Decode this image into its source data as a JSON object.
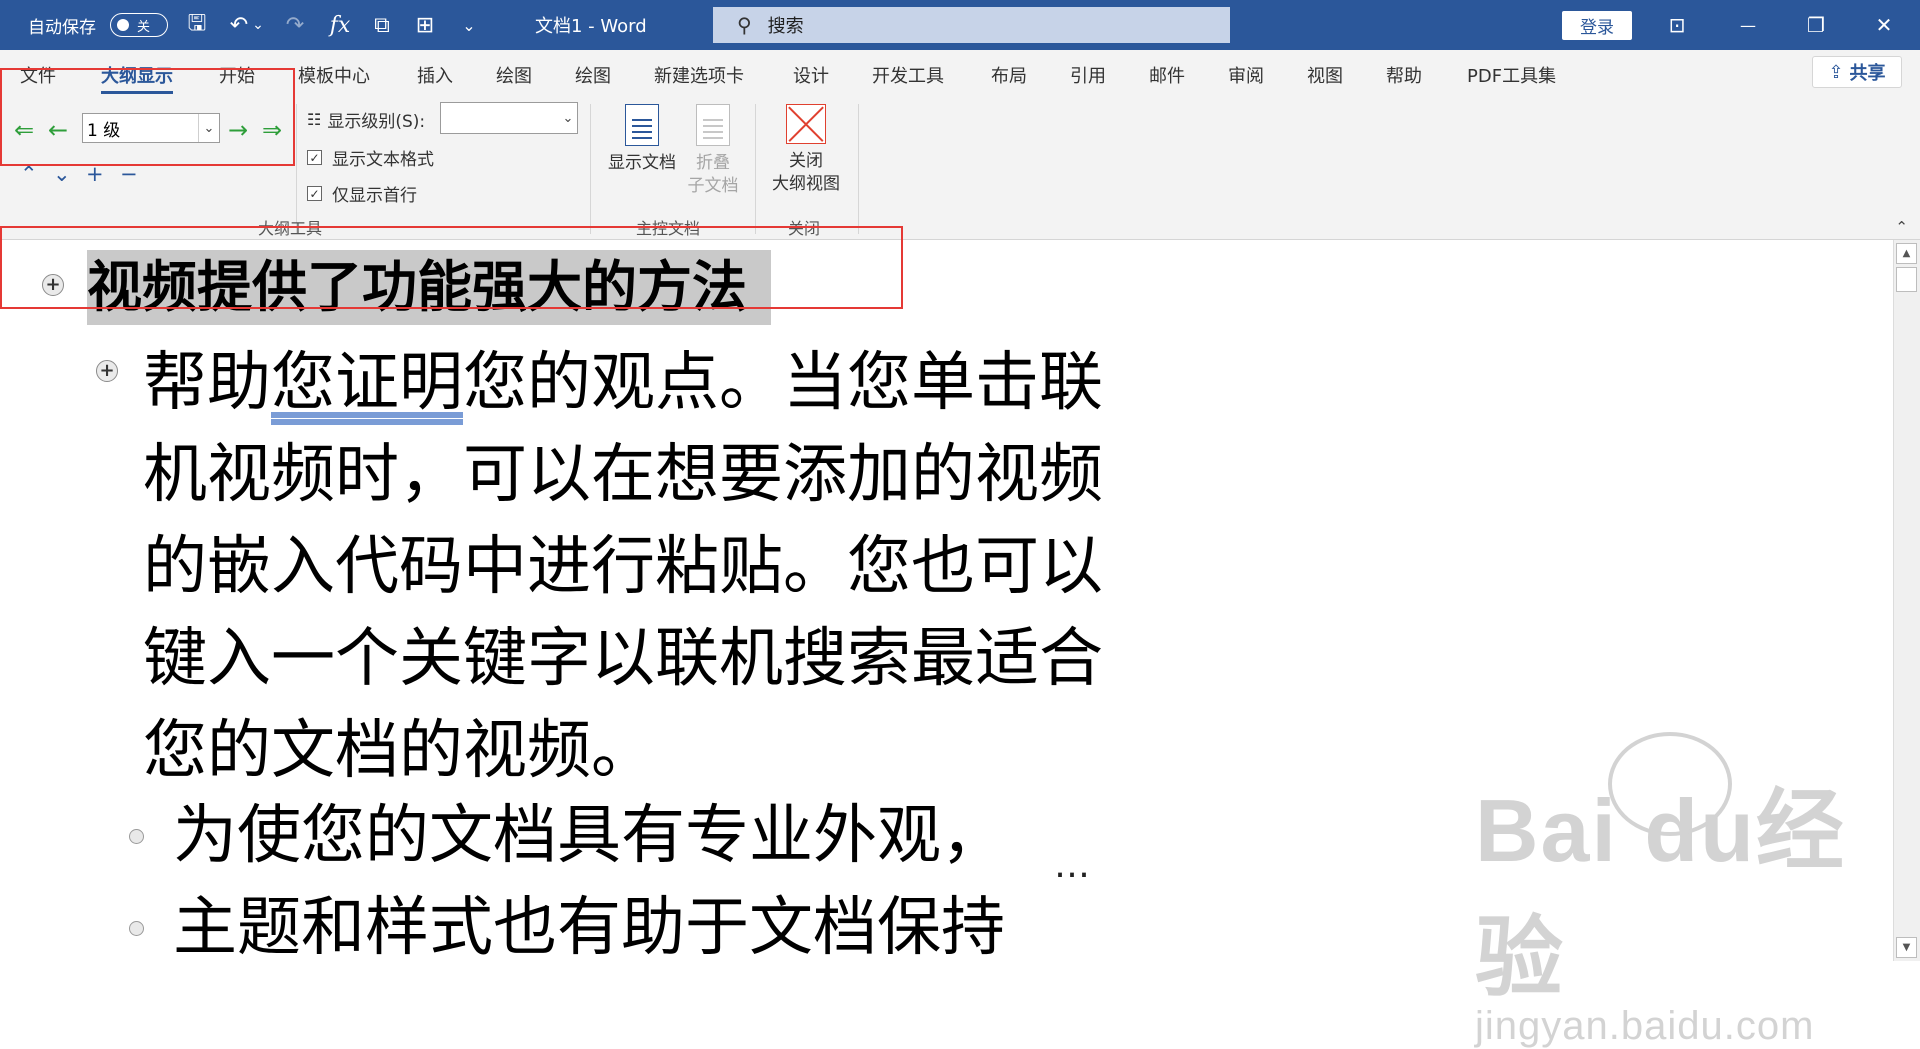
{
  "titlebar": {
    "autosave_label": "自动保存",
    "autosave_state": "关",
    "doc_title": "文档1 - Word",
    "search_placeholder": "搜索",
    "login_label": "登录",
    "quick_access": {
      "save": "🖫",
      "undo": "↶",
      "undo_dd": "⌄",
      "redo": "↷",
      "fx": "fx",
      "screen": "⧉",
      "tree": "⊞",
      "customize": "⌄"
    },
    "window_controls": {
      "ribbon_display": "⊡",
      "minimize": "—",
      "restore": "❐",
      "close": "✕"
    }
  },
  "tabs": [
    "文件",
    "大纲显示",
    "开始",
    "模板中心",
    "插入",
    "绘图",
    "绘图",
    "新建选项卡",
    "设计",
    "开发工具",
    "布局",
    "引用",
    "邮件",
    "审阅",
    "视图",
    "帮助",
    "PDF工具集"
  ],
  "share_label": "共享",
  "share_icon": "⇪",
  "ribbon": {
    "outline_tools": {
      "promote_to_heading1": "⇐",
      "promote": "←",
      "level_value": "1 级",
      "demote": "→",
      "demote_to_body": "⇒",
      "move_up": "⌃",
      "move_down": "⌄",
      "expand": "+",
      "collapse": "−",
      "show_level_label": "显示级别(S):",
      "show_level_value": "",
      "show_text_formatting": "显示文本格式",
      "show_first_line_only": "仅显示首行",
      "group_label": "大纲工具"
    },
    "master_document": {
      "show_document": "显示文档",
      "collapse_subdocs_line1": "折叠",
      "collapse_subdocs_line2": "子文档",
      "group_label": "主控文档"
    },
    "close": {
      "close_line1": "关闭",
      "close_line2": "大纲视图",
      "group_label": "关闭"
    },
    "collapse_ribbon": "⌃"
  },
  "document": {
    "heading1": "视频提供了功能强大的方法",
    "para_before_underline": "帮助",
    "para_underlined": "您证明",
    "para_after_underline": "您的观点。当您单击联机视频时，可以在想要添加的视频的嵌入代码中进行粘贴。您也可以键入一个关键字以联机搜索最适合您的文档的视频。",
    "sub_item_1": "为使您的文档具有专业外观，",
    "sub_item_2": "主题和样式也有助于文档保持",
    "ellipsis": "…",
    "plus_symbol": "+"
  },
  "watermark": {
    "brand": "Bai   du经验",
    "url": "jingyan.baidu.com"
  },
  "scrollbar": {
    "up": "▲",
    "down": "▼"
  },
  "colors": {
    "title_bar": "#2b579a",
    "ribbon_bg": "#f3f3f3",
    "highlight": "#e53935",
    "arrow_green": "#2e9e3a",
    "heading_shading": "#c9c9c9"
  }
}
